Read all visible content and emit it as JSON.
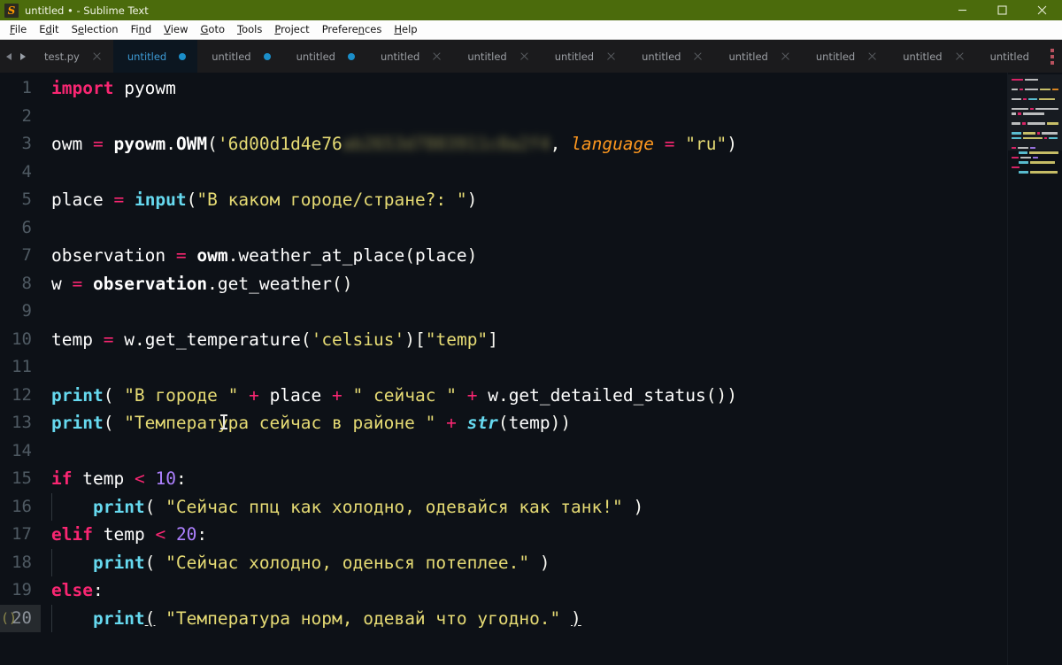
{
  "window": {
    "title": "untitled • - Sublime Text",
    "icon": "sublime-text-icon",
    "title_bar_color": "#4b6b0c",
    "minimize_label": "Minimize",
    "maximize_label": "Maximize",
    "close_label": "Close"
  },
  "menubar": {
    "items": [
      {
        "label": "File",
        "accel": "F"
      },
      {
        "label": "Edit",
        "accel": "E"
      },
      {
        "label": "Selection",
        "accel": "S"
      },
      {
        "label": "Find",
        "accel": "n"
      },
      {
        "label": "View",
        "accel": "V"
      },
      {
        "label": "Goto",
        "accel": "G"
      },
      {
        "label": "Tools",
        "accel": "T"
      },
      {
        "label": "Project",
        "accel": "P"
      },
      {
        "label": "Preferences",
        "accel": "n"
      },
      {
        "label": "Help",
        "accel": "H"
      }
    ]
  },
  "tabbar": {
    "prev_arrow_icon": "chevron-left-icon",
    "next_arrow_icon": "chevron-right-icon",
    "overflow_icon": "more-tabs-icon",
    "tabs": [
      {
        "label": "test.py",
        "active": false,
        "modified": false
      },
      {
        "label": "untitled",
        "active": true,
        "modified": true
      },
      {
        "label": "untitled",
        "active": false,
        "modified": true
      },
      {
        "label": "untitled",
        "active": false,
        "modified": true
      },
      {
        "label": "untitled",
        "active": false,
        "modified": false
      },
      {
        "label": "untitled",
        "active": false,
        "modified": false
      },
      {
        "label": "untitled",
        "active": false,
        "modified": false
      },
      {
        "label": "untitled",
        "active": false,
        "modified": false
      },
      {
        "label": "untitled",
        "active": false,
        "modified": false
      },
      {
        "label": "untitled",
        "active": false,
        "modified": false
      },
      {
        "label": "untitled",
        "active": false,
        "modified": false
      },
      {
        "label": "untitled",
        "active": false,
        "modified": false
      },
      {
        "label": "untitled",
        "active": false,
        "modified": false
      }
    ]
  },
  "editor": {
    "language": "Python",
    "current_line": 20,
    "bracket_match_indicator": "()",
    "line_numbers": [
      "1",
      "2",
      "3",
      "4",
      "5",
      "6",
      "7",
      "8",
      "9",
      "10",
      "11",
      "12",
      "13",
      "14",
      "15",
      "16",
      "17",
      "18",
      "19",
      "20"
    ],
    "lines": {
      "1": "import pyowm",
      "2": "",
      "3": "owm = pyowm.OWM('6d00d1d4e76",
      "3_redacted_suffix": "…', language = \"ru\")",
      "3_kwarg": "language",
      "3_kwarg_value": "\"ru\"",
      "4": "",
      "5": "place = input(\"В каком городе/стране?: \")",
      "6": "",
      "7": "observation = owm.weather_at_place(place)",
      "8": "w = observation.get_weather()",
      "9": "",
      "10": "temp = w.get_temperature('celsius')[\"temp\"]",
      "11": "",
      "12": "print( \"В городе \" + place + \" сейчас \" + w.get_detailed_status())",
      "13": "print( \"Температура сейчас в районе \" + str(temp))",
      "14": "",
      "15": "if temp < 10:",
      "16": "    print( \"Сейчас ппц как холодно, одевайся как танк!\" )",
      "17": "elif temp < 20:",
      "18": "    print( \"Сейчас холодно, оденься потеплее.\" )",
      "19": "else:",
      "20": "    print( \"Температура норм, одевай что угодно.\" )"
    },
    "tokens": {
      "kw_import": "import",
      "kw_if": "if",
      "kw_elif": "elif",
      "kw_else": "else",
      "fn_input": "input",
      "fn_print": "print",
      "fn_str": "str",
      "mod_pyowm": "pyowm",
      "var_owm": "owm",
      "var_place": "place",
      "var_observation": "observation",
      "var_w": "w",
      "var_temp": "temp",
      "num_10": "10",
      "num_20": "20",
      "str_celsius": "'celsius'",
      "str_temp_key": "\"temp\"",
      "api_key_visible": "'6d00d1d4e76",
      "api_key_redacted": true
    },
    "colors": {
      "background": "#0d1117",
      "foreground": "#e6e6e6",
      "keyword": "#f92672",
      "function": "#66d9ef",
      "string": "#e6db74",
      "number": "#ae81ff",
      "operator": "#f92672",
      "argument": "#fd971f",
      "gutter_text": "#4f5a63",
      "current_line_gutter": "#262a2e"
    }
  },
  "minimap": {
    "name": "code-minimap",
    "visible": true
  }
}
